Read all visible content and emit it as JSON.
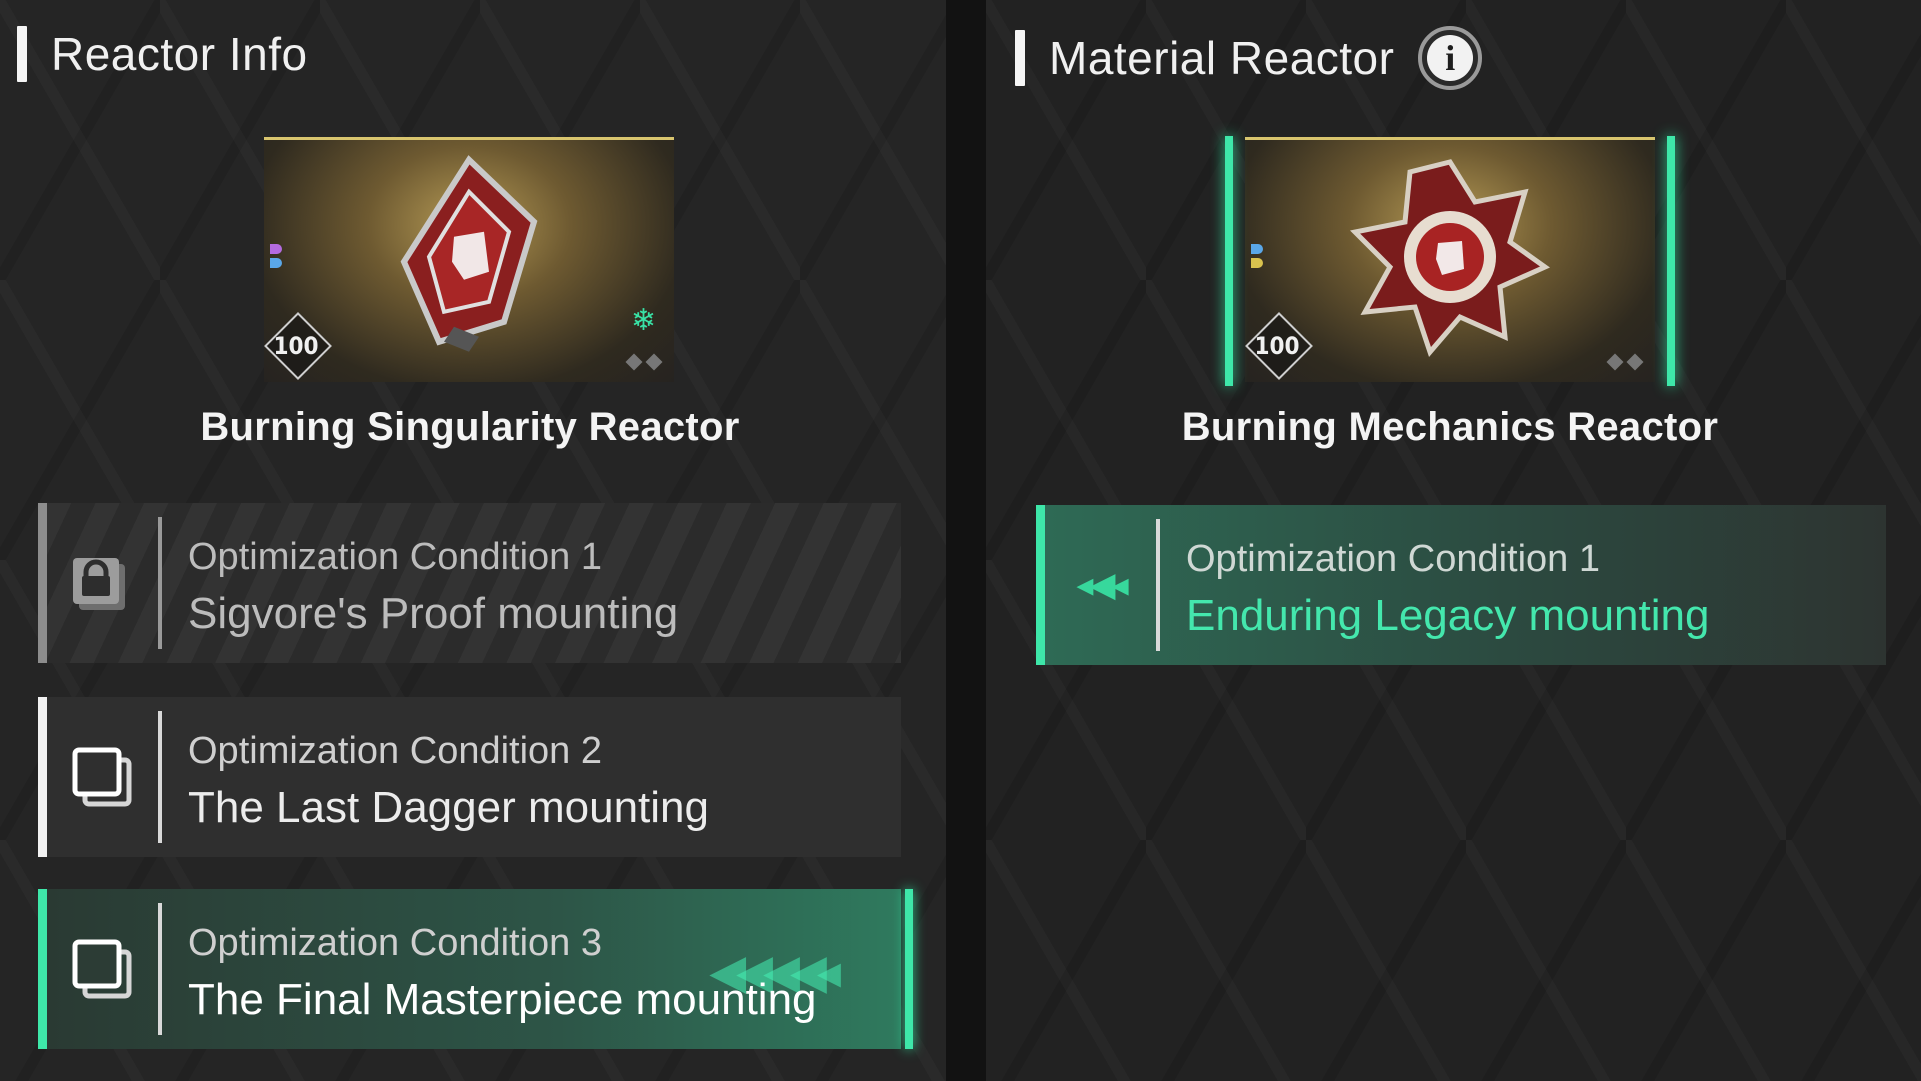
{
  "left_panel": {
    "title": "Reactor Info",
    "card": {
      "name": "Burning Singularity Reactor",
      "level": "100"
    },
    "conditions": [
      {
        "label": "Optimization Condition 1",
        "value": "Sigvore's Proof mounting",
        "state": "locked",
        "icon": "lock-icon"
      },
      {
        "label": "Optimization Condition 2",
        "value": "The Last Dagger mounting",
        "state": "normal",
        "icon": "stacked-squares-icon"
      },
      {
        "label": "Optimization Condition 3",
        "value": "The Final Masterpiece mounting",
        "state": "selected",
        "icon": "stacked-squares-icon"
      }
    ]
  },
  "right_panel": {
    "title": "Material Reactor",
    "info_icon": "info-icon",
    "card": {
      "name": "Burning Mechanics Reactor",
      "level": "100"
    },
    "conditions": [
      {
        "label": "Optimization Condition 1",
        "value": "Enduring Legacy mounting",
        "state": "matched",
        "icon": "arrows-left-icon"
      }
    ]
  },
  "colors": {
    "accent": "#3ee7a9",
    "background": "#232323",
    "card_gold": "#d9c56e",
    "highlight_text": "#44e7ad"
  }
}
